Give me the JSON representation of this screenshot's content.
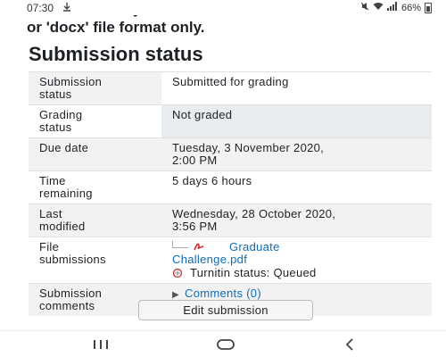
{
  "status_bar": {
    "time": "07:30",
    "battery": "66%"
  },
  "notice": {
    "line1": "Please submit your assessment in 'PDF'",
    "line2": "or 'docx' file format only."
  },
  "section_title": "Submission status",
  "rows": {
    "submission_status": {
      "label_1": "Submission",
      "label_2": "status",
      "value": "Submitted for grading"
    },
    "grading_status": {
      "label_1": "Grading",
      "label_2": "status",
      "value": "Not graded"
    },
    "due_date": {
      "label_1": "Due date",
      "value_1": "Tuesday, 3 November 2020,",
      "value_2": "2:00 PM"
    },
    "time_remaining": {
      "label_1": "Time",
      "label_2": "remaining",
      "value": "5 days 6 hours"
    },
    "last_modified": {
      "label_1": "Last",
      "label_2": "modified",
      "value_1": "Wednesday, 28 October 2020,",
      "value_2": "3:56 PM"
    },
    "file_submissions": {
      "label_1": "File",
      "label_2": "submissions",
      "file_name_1": "Graduate",
      "file_name_2": "Challenge.pdf",
      "turnitin": "Turnitin status: Queued"
    },
    "submission_comments": {
      "label_1": "Submission",
      "label_2": "comments",
      "link": "Comments (0)"
    }
  },
  "edit_button": "Edit submission",
  "icons": {
    "pdf": "pdf-file-icon",
    "turnitin": "turnitin-icon",
    "collapse": "triangle-right-icon"
  },
  "colors": {
    "link": "#0f6cbf",
    "pdf_red": "#d32f2f"
  }
}
